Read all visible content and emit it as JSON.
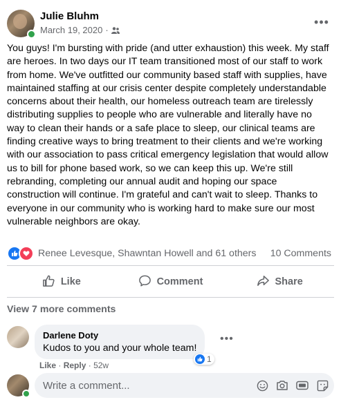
{
  "post": {
    "author": "Julie Bluhm",
    "date": "March 19, 2020",
    "audience_icon": "friends-icon",
    "more_label": "•••",
    "body": "You guys! I'm bursting with pride (and utter exhaustion) this week. My staff are heroes. In two days our IT team transitioned most of our staff to work from home. We've outfitted our community based staff with supplies, have maintained staffing at our crisis center despite completely understandable concerns about their health, our homeless outreach team are tirelessly distributing supplies to people who are vulnerable and literally have no way to clean their hands or a safe place to sleep, our clinical teams are finding creative ways to bring treatment to their clients and we're working with our association to pass critical emergency legislation that would allow us to bill for phone based work, so we can keep this up. We're still rebranding, completing our annual audit and hoping our space construction will continue. I'm grateful and can't wait to sleep. Thanks to everyone in our community who is working hard to make sure our most vulnerable neighbors are okay."
  },
  "reactions": {
    "names": "Renee Levesque, Shawntan Howell and 61 others",
    "comments": "10 Comments",
    "icons": [
      "like-icon",
      "love-icon"
    ]
  },
  "actions": {
    "like": "Like",
    "comment": "Comment",
    "share": "Share"
  },
  "comments": {
    "view_more": "View 7 more comments",
    "items": [
      {
        "author": "Darlene Doty",
        "text": "Kudos to you and your whole team!",
        "like_link": "Like",
        "separator": "·",
        "reply_link": "Reply",
        "age": "52w",
        "reaction_count": "1",
        "more_label": "•••"
      }
    ]
  },
  "composer": {
    "placeholder": "Write a comment...",
    "icons": [
      "emoji-icon",
      "camera-icon",
      "gif-icon",
      "sticker-icon"
    ]
  },
  "colors": {
    "like_blue": "#1877f2",
    "love_red": "#f33e58",
    "online_green": "#31a24c",
    "secondary_text": "#65676b"
  }
}
